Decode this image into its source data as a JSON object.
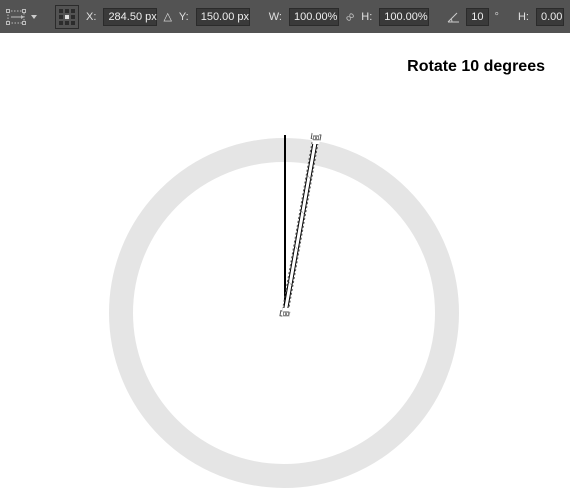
{
  "bar": {
    "x_label": "X:",
    "x_value": "284.50 px",
    "delta": "△",
    "y_label": "Y:",
    "y_value": "150.00 px",
    "w_label": "W:",
    "w_value": "100.00%",
    "link": "∞",
    "h_label": "H:",
    "h_value": "100.00%",
    "angle_value": "10",
    "deg": "°",
    "skew_h_label": "H:",
    "skew_h_value": "0.00"
  },
  "caption": "Rotate 10 degrees",
  "caption_font_size": "16px"
}
